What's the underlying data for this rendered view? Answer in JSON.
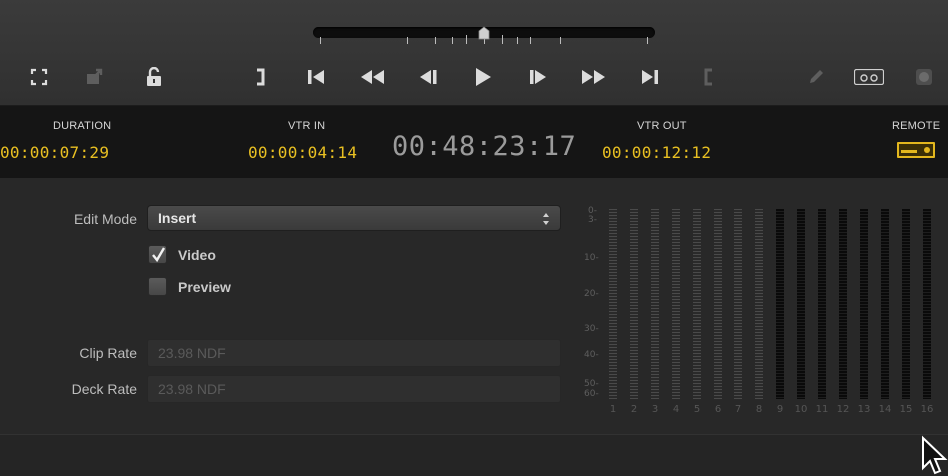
{
  "timecodes": {
    "duration_label": "DURATION",
    "duration_value": "00:00:07:29",
    "vtr_in_label": "VTR IN",
    "vtr_in_value": "00:00:04:14",
    "current": "00:48:23:17",
    "vtr_out_label": "VTR OUT",
    "vtr_out_value": "00:00:12:12",
    "remote_label": "REMOTE"
  },
  "toolbar": {
    "icons": [
      "fullscreen-icon",
      "export-icon",
      "unlock-icon",
      "mark-out-icon",
      "go-to-start-icon",
      "rewind-icon",
      "step-back-icon",
      "play-icon",
      "step-forward-icon",
      "fast-forward-icon",
      "go-to-end-icon",
      "mark-in-icon",
      "pencil-icon",
      "tape-icon",
      "record-icon"
    ]
  },
  "settings": {
    "edit_mode_label": "Edit Mode",
    "edit_mode_value": "Insert",
    "video_label": "Video",
    "video_checked": true,
    "preview_label": "Preview",
    "preview_checked": false,
    "clip_rate_label": "Clip Rate",
    "clip_rate_value": "23.98 NDF",
    "deck_rate_label": "Deck Rate",
    "deck_rate_value": "23.98 NDF"
  },
  "meters": {
    "scale": [
      "0-",
      "3-",
      "10-",
      "20-",
      "30-",
      "40-",
      "50-",
      "60-"
    ],
    "channels": [
      "1",
      "2",
      "3",
      "4",
      "5",
      "6",
      "7",
      "8",
      "9",
      "10",
      "11",
      "12",
      "13",
      "14",
      "15",
      "16"
    ],
    "active_channels": 8
  },
  "colors": {
    "timecode": "#e9c022",
    "background": "#2b2b2b",
    "strip": "#151515"
  }
}
